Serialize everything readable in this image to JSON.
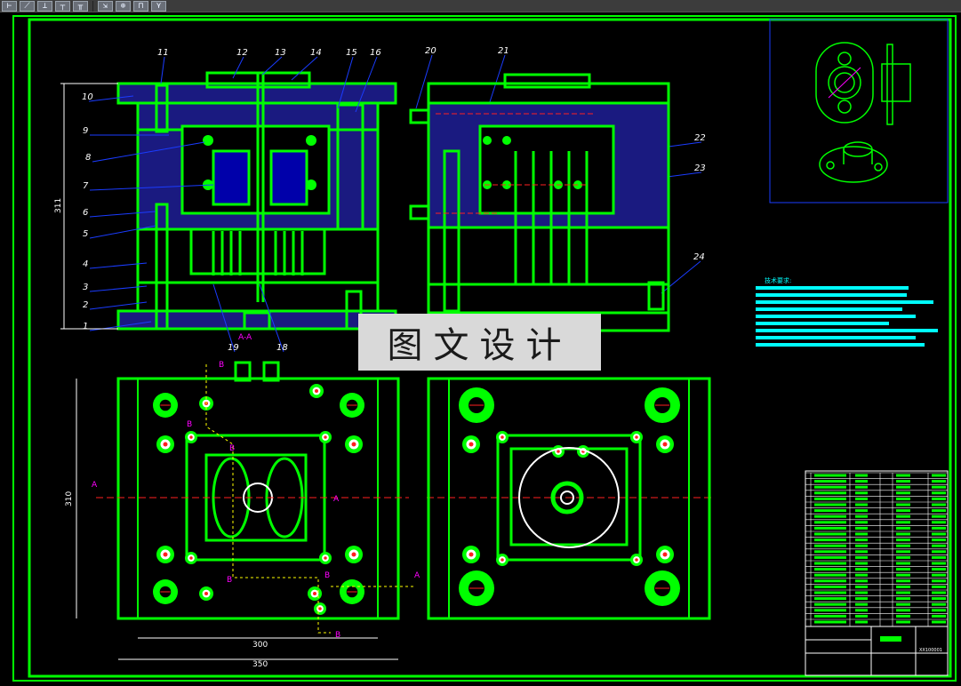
{
  "toolbar": {
    "buttons": [
      {
        "name": "dimension-tool-1",
        "glyph": "⊢"
      },
      {
        "name": "dimension-tool-2",
        "glyph": "⟋"
      },
      {
        "name": "dimension-tool-3",
        "glyph": "⊥"
      },
      {
        "name": "dimension-tool-4",
        "glyph": "┬"
      },
      {
        "name": "dimension-tool-5",
        "glyph": "╥"
      },
      {
        "name": "dimension-tool-6",
        "glyph": "⇲"
      },
      {
        "name": "center-mark-tool",
        "glyph": "⊕"
      },
      {
        "name": "dimension-tool-8",
        "glyph": "⊓"
      },
      {
        "name": "dimension-tool-9",
        "glyph": "⋎"
      }
    ]
  },
  "drawing": {
    "colors": {
      "outline": "#00ff00",
      "leader": "#1a3cff",
      "labels": "#ffffff",
      "dimension": "#ffffff",
      "section": "#ff00ff",
      "center": "#ff2020",
      "hatch": "#1a1a80",
      "text_block": "#00ffff"
    },
    "part_numbers": [
      "1",
      "2",
      "3",
      "4",
      "5",
      "6",
      "7",
      "8",
      "9",
      "10",
      "11",
      "12",
      "13",
      "14",
      "15",
      "16",
      "18",
      "19",
      "20",
      "21",
      "22",
      "23",
      "24"
    ],
    "dimensions": {
      "height": "311",
      "plan_height": "310",
      "inner_width": "300",
      "outer_width": "350"
    },
    "section_labels": {
      "a": "A",
      "b": "B",
      "aa": "A-A"
    },
    "tech_requirements_title": "技术要求:",
    "title_block_code": "XX100001"
  },
  "watermark": {
    "text": "图文设计"
  }
}
